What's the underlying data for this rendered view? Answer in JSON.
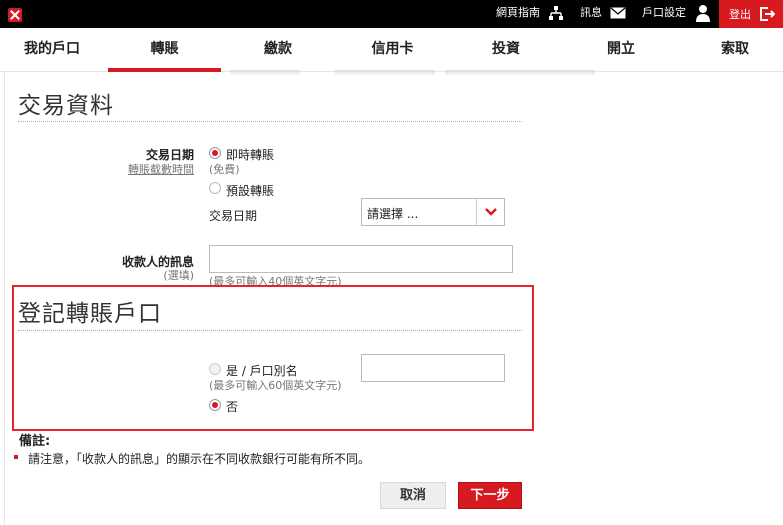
{
  "header": {
    "links": [
      {
        "label": "網頁指南"
      },
      {
        "label": "訊息"
      },
      {
        "label": "戶口設定"
      }
    ],
    "logout_label": "登出"
  },
  "nav": {
    "items": [
      {
        "label": "我的戶口"
      },
      {
        "label": "轉賬"
      },
      {
        "label": "繳款"
      },
      {
        "label": "信用卡"
      },
      {
        "label": "投資"
      },
      {
        "label": "開立"
      },
      {
        "label": "索取"
      }
    ],
    "active_index": 1
  },
  "transaction": {
    "section_title": "交易資料",
    "date_label": "交易日期",
    "cutoff_link": "轉賬截數時間",
    "immediate_label": "即時轉賬",
    "immediate_hint": "(免費)",
    "scheduled_label": "預設轉賬",
    "date_field_label": "交易日期",
    "date_select_value": "請選擇 ...",
    "message_label": "收款人的訊息",
    "message_optional": "(選填)",
    "message_hint": "(最多可輸入40個英文字元)",
    "message_value": ""
  },
  "register": {
    "section_title": "登記轉賬戶口",
    "yes_label": "是 / 戶口別名",
    "yes_hint": "(最多可輸入60個英文字元)",
    "alias_value": "",
    "no_label": "否"
  },
  "note": {
    "title": "備註:",
    "text": "請注意，「收款人的訊息」的顯示在不同收款銀行可能有所不同。"
  },
  "buttons": {
    "cancel_label": "取消",
    "next_label": "下一步"
  },
  "colors": {
    "brand_red": "#d71920",
    "highlight_red": "#e3262d",
    "topbar": "#000000"
  },
  "icons": [
    "close-logo-icon",
    "sitemap-icon",
    "mail-icon",
    "user-icon",
    "logout-icon",
    "chevron-down-icon"
  ]
}
